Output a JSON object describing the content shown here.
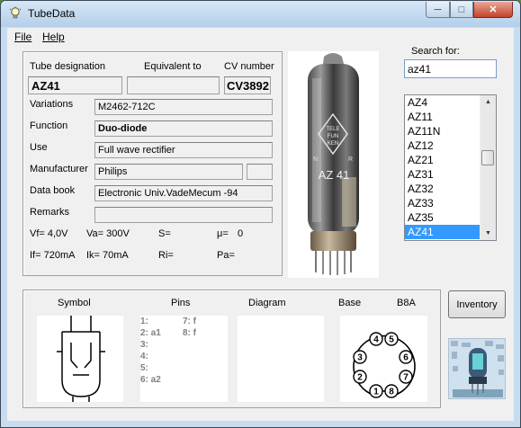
{
  "window": {
    "title": "TubeData"
  },
  "menu": {
    "file": "File",
    "help": "Help"
  },
  "tube": {
    "designation_label": "Tube designation",
    "equivalent_label": "Equivalent to",
    "cv_label": "CV number",
    "designation": "AZ41",
    "equivalent": "",
    "cv": "CV3892",
    "variations_label": "Variations",
    "variations": "M2462-712C",
    "function_label": "Function",
    "function": "Duo-diode",
    "use_label": "Use",
    "use": "Full wave rectifier",
    "manufacturer_label": "Manufacturer",
    "manufacturer": "Philips",
    "manufacturer_extra": "",
    "databook_label": "Data book",
    "databook": "Electronic Univ.VadeMecum -94",
    "remarks_label": "Remarks",
    "remarks": ""
  },
  "params": {
    "vf": "Vf= 4,0V",
    "va": "Va=  300V",
    "s": "S=",
    "mu": "μ=",
    "mu_val": "0",
    "if": "If= 720mA",
    "ik": "Ik=  70mA",
    "ri": "Ri=",
    "pa": "Pa="
  },
  "search": {
    "label": "Search for:",
    "value": "az41"
  },
  "tube_list": {
    "items": [
      "AZ4",
      "AZ11",
      "AZ11N",
      "AZ12",
      "AZ21",
      "AZ31",
      "AZ32",
      "AZ33",
      "AZ35",
      "AZ41"
    ],
    "selected": "AZ41"
  },
  "photo": {
    "brand_top": "TELE",
    "brand_mid": "FUN",
    "brand_bot": "KEN",
    "tube_name": "AZ 41",
    "side_a": "N",
    "side_b": "R"
  },
  "bottom": {
    "symbol_label": "Symbol",
    "pins_label": "Pins",
    "diagram_label": "Diagram",
    "base_label": "Base",
    "base_type": "B8A",
    "pins_left": "1:\n2: a1\n3:\n4:\n5:\n6: a2",
    "pins_right": "7: f\n8: f",
    "base_pins": [
      "1",
      "2",
      "3",
      "4",
      "5",
      "6",
      "7",
      "8"
    ]
  },
  "buttons": {
    "inventory": "Inventory"
  },
  "colors": {
    "selection": "#3399ff",
    "title_bar": "#c8dcef",
    "close_button": "#c5412a"
  }
}
